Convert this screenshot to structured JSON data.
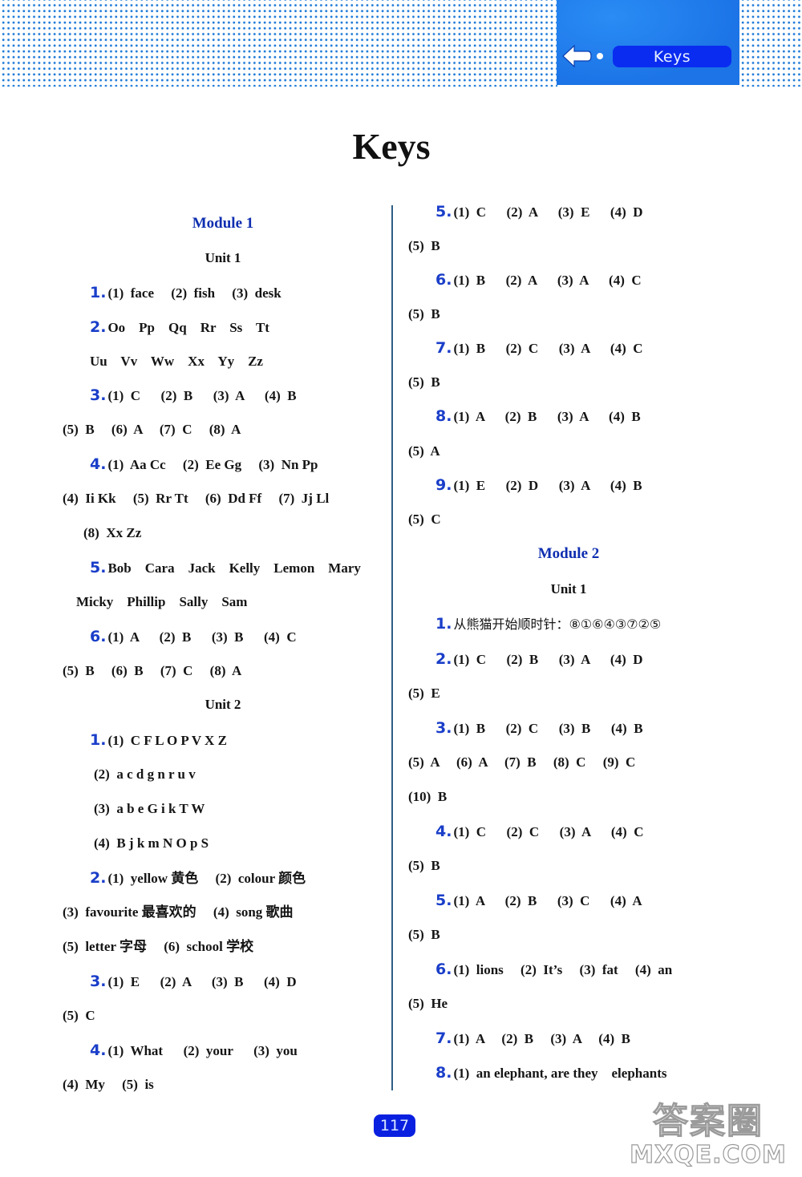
{
  "header": {
    "tab_label": "Keys",
    "icons": {
      "back": "arrow-left-icon",
      "dot": "dot-icon"
    }
  },
  "title": "Keys",
  "left_column": {
    "module_title": "Module 1",
    "unit1_title": "Unit 1",
    "unit2_title": "Unit 2",
    "lines": [
      {
        "num": "1.",
        "text": "(1)  face     (2)  fish     (3)  desk"
      },
      {
        "num": "2.",
        "text": "Oo    Pp    Qq    Rr    Ss    Tt"
      },
      {
        "num": "",
        "text": "Uu    Vv    Ww    Xx    Yy    Zz"
      },
      {
        "num": "3.",
        "text": "(1)  C      (2)  B      (3)  A      (4)  B"
      },
      {
        "num": "",
        "text": "(5)  B     (6)  A     (7)  C     (8)  A"
      },
      {
        "num": "4.",
        "text": "(1)  Aa Cc     (2)  Ee Gg     (3)  Nn Pp"
      },
      {
        "num": "",
        "text": "(4)  Ii Kk     (5)  Rr Tt     (6)  Dd Ff     (7)  Jj Ll"
      },
      {
        "num": "",
        "text": "(8)  Xx Zz"
      },
      {
        "num": "5.",
        "text": "Bob    Cara    Jack    Kelly    Lemon    Mary"
      },
      {
        "num": "",
        "text": "Micky    Phillip    Sally    Sam"
      },
      {
        "num": "6.",
        "text": "(1)  A      (2)  B      (3)  B      (4)  C"
      },
      {
        "num": "",
        "text": "(5)  B     (6)  B     (7)  C     (8)  A"
      },
      {
        "num": "1.",
        "text": "(1)  C F L O P V X Z"
      },
      {
        "num": "",
        "text": "(2)  a c d g n r u v"
      },
      {
        "num": "",
        "text": "(3)  a b e G i k T W"
      },
      {
        "num": "",
        "text": "(4)  B j k m N O p S"
      },
      {
        "num": "2.",
        "text": "(1)  yellow 黄色     (2)  colour 颜色"
      },
      {
        "num": "",
        "text": "(3)  favourite 最喜欢的     (4)  song 歌曲"
      },
      {
        "num": "",
        "text": "(5)  letter 字母     (6)  school 学校"
      },
      {
        "num": "3.",
        "text": "(1)  E      (2)  A      (3)  B      (4)  D"
      },
      {
        "num": "",
        "text": "(5)  C"
      },
      {
        "num": "4.",
        "text": "(1)  What      (2)  your      (3)  you"
      },
      {
        "num": "",
        "text": "(4)  My     (5)  is"
      }
    ]
  },
  "right_column": {
    "module_title": "Module 2",
    "unit1_title": "Unit 1",
    "lines": [
      {
        "num": "5.",
        "text": "(1)  C      (2)  A      (3)  E      (4)  D"
      },
      {
        "num": "",
        "text": "(5)  B"
      },
      {
        "num": "6.",
        "text": "(1)  B      (2)  A      (3)  A      (4)  C"
      },
      {
        "num": "",
        "text": "(5)  B"
      },
      {
        "num": "7.",
        "text": "(1)  B      (2)  C      (3)  A      (4)  C"
      },
      {
        "num": "",
        "text": "(5)  B"
      },
      {
        "num": "8.",
        "text": "(1)  A      (2)  B      (3)  A      (4)  B"
      },
      {
        "num": "",
        "text": "(5)  A"
      },
      {
        "num": "9.",
        "text": "(1)  E      (2)  D      (3)  A      (4)  B"
      },
      {
        "num": "",
        "text": "(5)  C"
      },
      {
        "num": "1.",
        "text": "从熊猫开始顺时针：⑧①⑥④③⑦②⑤"
      },
      {
        "num": "2.",
        "text": "(1)  C      (2)  B      (3)  A      (4)  D"
      },
      {
        "num": "",
        "text": "(5)  E"
      },
      {
        "num": "3.",
        "text": "(1)  B      (2)  C      (3)  B      (4)  B"
      },
      {
        "num": "",
        "text": "(5)  A     (6)  A     (7)  B     (8)  C     (9)  C"
      },
      {
        "num": "",
        "text": "(10)  B"
      },
      {
        "num": "4.",
        "text": "(1)  C      (2)  C      (3)  A      (4)  C"
      },
      {
        "num": "",
        "text": "(5)  B"
      },
      {
        "num": "5.",
        "text": "(1)  A      (2)  B      (3)  C      (4)  A"
      },
      {
        "num": "",
        "text": "(5)  B"
      },
      {
        "num": "6.",
        "text": "(1)  lions     (2)  It’s     (3)  fat     (4)  an"
      },
      {
        "num": "",
        "text": "(5)  He"
      },
      {
        "num": "7.",
        "text": "(1)  A     (2)  B     (3)  A     (4)  B"
      },
      {
        "num": "8.",
        "text": "(1)  an elephant, are they    elephants"
      }
    ]
  },
  "footer": {
    "page_number": "117",
    "watermark_cn": "答案圈",
    "watermark_en": "MXQE.COM"
  }
}
